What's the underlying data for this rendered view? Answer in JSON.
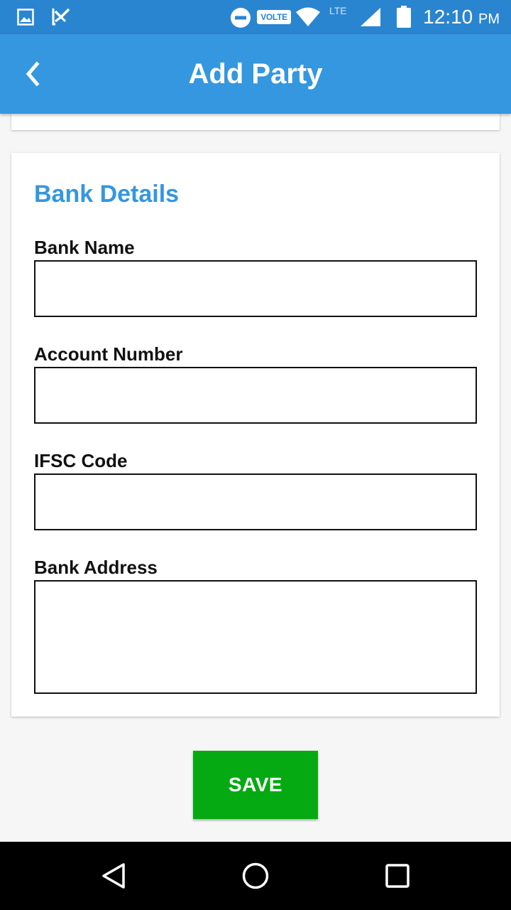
{
  "status_bar": {
    "volte_label": "VOLTE",
    "network_label": "LTE",
    "time": "12:10",
    "ampm": "PM"
  },
  "app_bar": {
    "title": "Add Party",
    "back_icon": "chevron-left-icon"
  },
  "section": {
    "title": "Bank Details",
    "fields": [
      {
        "label": "Bank Name",
        "value": ""
      },
      {
        "label": "Account Number",
        "value": ""
      },
      {
        "label": "IFSC Code",
        "value": ""
      },
      {
        "label": "Bank Address",
        "value": ""
      }
    ]
  },
  "save_label": "SAVE",
  "nav": {
    "back_icon": "nav-back-icon",
    "home_icon": "nav-home-icon",
    "recents_icon": "nav-recents-icon"
  },
  "colors": {
    "status_bar": "#2a85d0",
    "app_bar": "#3497e0",
    "accent": "#3497e0",
    "save_button": "#05aa12",
    "background": "#f6f6f6"
  }
}
